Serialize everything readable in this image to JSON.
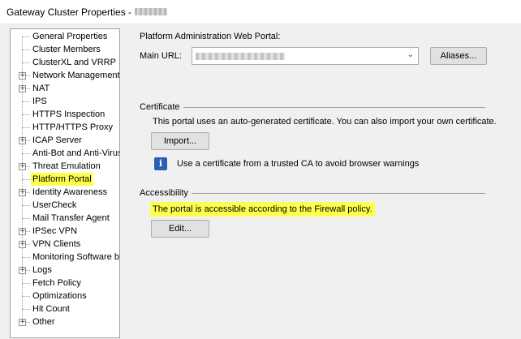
{
  "window": {
    "title": "Gateway Cluster Properties - "
  },
  "tree": {
    "items": [
      {
        "label": "General Properties",
        "expandable": false,
        "selected": false
      },
      {
        "label": "Cluster Members",
        "expandable": false,
        "selected": false
      },
      {
        "label": "ClusterXL and VRRP",
        "expandable": false,
        "selected": false
      },
      {
        "label": "Network Management",
        "expandable": true,
        "selected": false
      },
      {
        "label": "NAT",
        "expandable": true,
        "selected": false
      },
      {
        "label": "IPS",
        "expandable": false,
        "selected": false
      },
      {
        "label": "HTTPS Inspection",
        "expandable": false,
        "selected": false
      },
      {
        "label": "HTTP/HTTPS Proxy",
        "expandable": false,
        "selected": false
      },
      {
        "label": "ICAP Server",
        "expandable": true,
        "selected": false
      },
      {
        "label": "Anti-Bot and Anti-Virus",
        "expandable": false,
        "selected": false
      },
      {
        "label": "Threat Emulation",
        "expandable": true,
        "selected": false
      },
      {
        "label": "Platform Portal",
        "expandable": false,
        "selected": true
      },
      {
        "label": "Identity Awareness",
        "expandable": true,
        "selected": false
      },
      {
        "label": "UserCheck",
        "expandable": false,
        "selected": false
      },
      {
        "label": "Mail Transfer Agent",
        "expandable": false,
        "selected": false
      },
      {
        "label": "IPSec VPN",
        "expandable": true,
        "selected": false
      },
      {
        "label": "VPN Clients",
        "expandable": true,
        "selected": false
      },
      {
        "label": "Monitoring Software bla",
        "expandable": false,
        "selected": false
      },
      {
        "label": "Logs",
        "expandable": true,
        "selected": false
      },
      {
        "label": "Fetch Policy",
        "expandable": false,
        "selected": false
      },
      {
        "label": "Optimizations",
        "expandable": false,
        "selected": false
      },
      {
        "label": "Hit Count",
        "expandable": false,
        "selected": false
      },
      {
        "label": "Other",
        "expandable": true,
        "selected": false
      }
    ]
  },
  "portal": {
    "heading": "Platform Administration Web Portal:",
    "main_url_label": "Main URL:",
    "aliases_button": "Aliases..."
  },
  "certificate": {
    "group_title": "Certificate",
    "description": "This portal uses an auto-generated certificate. You can also import your own certificate.",
    "import_button": "Import...",
    "info_icon_glyph": "i",
    "info_text": "Use a certificate from a trusted CA to avoid browser warnings"
  },
  "accessibility": {
    "group_title": "Accessibility",
    "status_text": "The portal is accessible according to the Firewall policy.",
    "edit_button": "Edit..."
  },
  "colors": {
    "highlight": "#ffff4d",
    "info_icon": "#2b5fb4"
  }
}
